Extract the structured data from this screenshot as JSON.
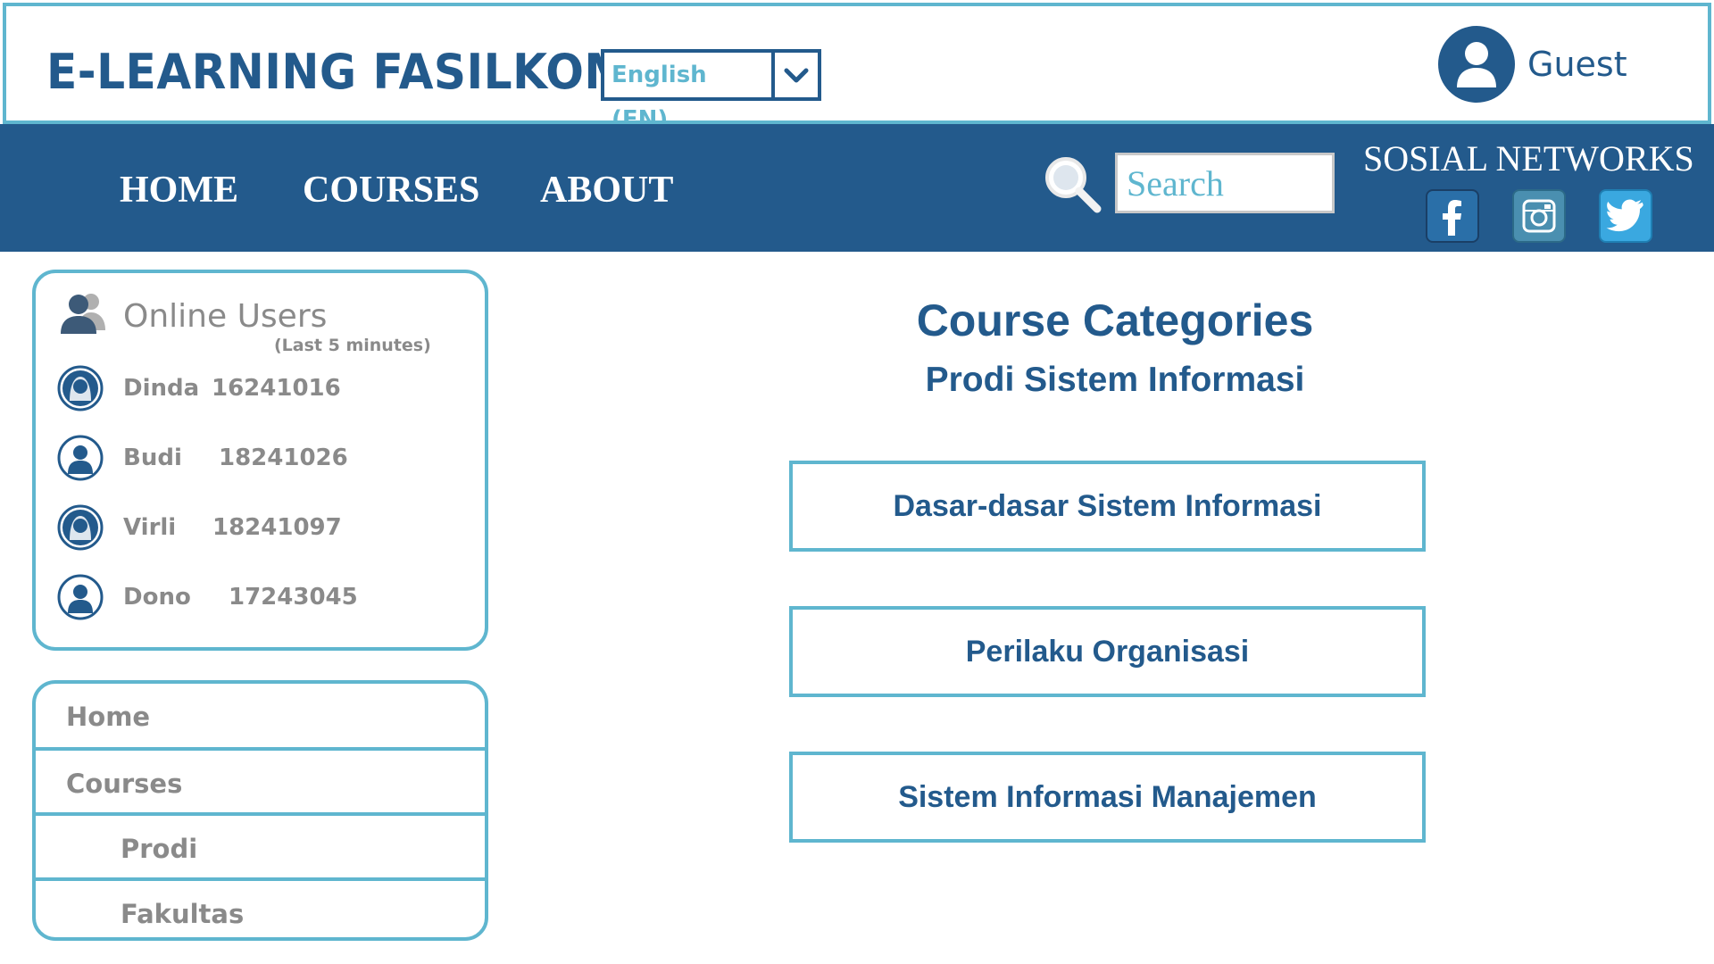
{
  "header": {
    "site_title": "E-LEARNING FASILKOM",
    "language": {
      "selected": "English (EN)"
    },
    "user": {
      "name": "Guest"
    }
  },
  "nav": {
    "items": [
      {
        "label": "HOME"
      },
      {
        "label": "COURSES"
      },
      {
        "label": "ABOUT"
      }
    ],
    "search": {
      "placeholder": "Search"
    },
    "social": {
      "title": "SOSIAL NETWORKS",
      "items": [
        {
          "icon": "facebook-icon",
          "color": "#2a6fa8"
        },
        {
          "icon": "instagram-icon",
          "color": "#4a8fb0"
        },
        {
          "icon": "twitter-icon",
          "color": "#3aa8e0"
        }
      ]
    }
  },
  "online_users": {
    "title": "Online Users",
    "subtitle": "(Last 5 minutes)",
    "users": [
      {
        "name": "Dinda",
        "id": "16241016"
      },
      {
        "name": "Budi",
        "id": "18241026"
      },
      {
        "name": "Virli",
        "id": "18241097"
      },
      {
        "name": "Dono",
        "id": "17243045"
      }
    ]
  },
  "side_nav": {
    "items": [
      {
        "label": "Home"
      },
      {
        "label": "Courses"
      },
      {
        "label": "Prodi"
      },
      {
        "label": "Fakultas"
      }
    ]
  },
  "main": {
    "title": "Course Categories",
    "subtitle": "Prodi Sistem Informasi",
    "courses": [
      {
        "label": "Dasar-dasar Sistem Informasi"
      },
      {
        "label": "Perilaku Organisasi"
      },
      {
        "label": "Sistem Informasi Manajemen"
      }
    ]
  },
  "colors": {
    "primary": "#235a8c",
    "accent": "#5fb6cf",
    "muted_text": "#8a8a8a"
  }
}
